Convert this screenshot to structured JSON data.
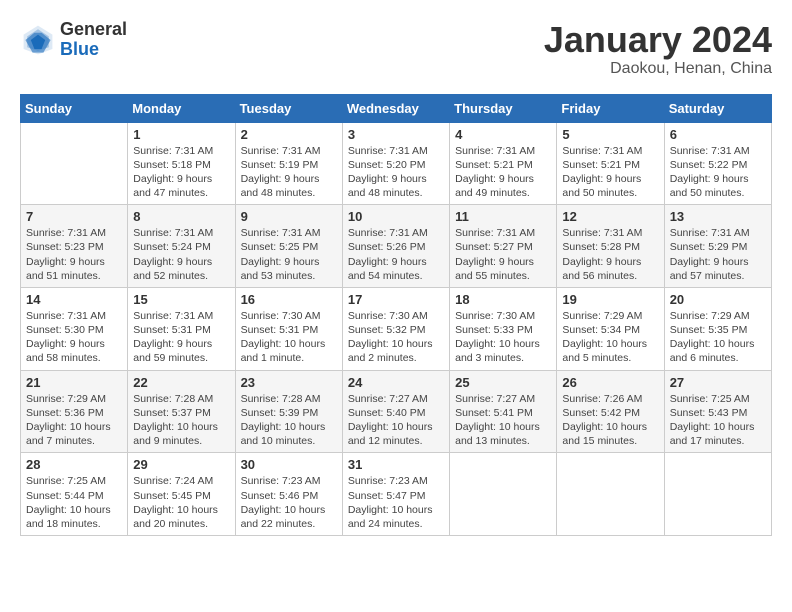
{
  "header": {
    "logo": {
      "general": "General",
      "blue": "Blue"
    },
    "title": "January 2024",
    "location": "Daokou, Henan, China"
  },
  "weekdays": [
    "Sunday",
    "Monday",
    "Tuesday",
    "Wednesday",
    "Thursday",
    "Friday",
    "Saturday"
  ],
  "weeks": [
    [
      {
        "day": "",
        "sunrise": "",
        "sunset": "",
        "daylight": ""
      },
      {
        "day": "1",
        "sunrise": "Sunrise: 7:31 AM",
        "sunset": "Sunset: 5:18 PM",
        "daylight": "Daylight: 9 hours and 47 minutes."
      },
      {
        "day": "2",
        "sunrise": "Sunrise: 7:31 AM",
        "sunset": "Sunset: 5:19 PM",
        "daylight": "Daylight: 9 hours and 48 minutes."
      },
      {
        "day": "3",
        "sunrise": "Sunrise: 7:31 AM",
        "sunset": "Sunset: 5:20 PM",
        "daylight": "Daylight: 9 hours and 48 minutes."
      },
      {
        "day": "4",
        "sunrise": "Sunrise: 7:31 AM",
        "sunset": "Sunset: 5:21 PM",
        "daylight": "Daylight: 9 hours and 49 minutes."
      },
      {
        "day": "5",
        "sunrise": "Sunrise: 7:31 AM",
        "sunset": "Sunset: 5:21 PM",
        "daylight": "Daylight: 9 hours and 50 minutes."
      },
      {
        "day": "6",
        "sunrise": "Sunrise: 7:31 AM",
        "sunset": "Sunset: 5:22 PM",
        "daylight": "Daylight: 9 hours and 50 minutes."
      }
    ],
    [
      {
        "day": "7",
        "sunrise": "Sunrise: 7:31 AM",
        "sunset": "Sunset: 5:23 PM",
        "daylight": "Daylight: 9 hours and 51 minutes."
      },
      {
        "day": "8",
        "sunrise": "Sunrise: 7:31 AM",
        "sunset": "Sunset: 5:24 PM",
        "daylight": "Daylight: 9 hours and 52 minutes."
      },
      {
        "day": "9",
        "sunrise": "Sunrise: 7:31 AM",
        "sunset": "Sunset: 5:25 PM",
        "daylight": "Daylight: 9 hours and 53 minutes."
      },
      {
        "day": "10",
        "sunrise": "Sunrise: 7:31 AM",
        "sunset": "Sunset: 5:26 PM",
        "daylight": "Daylight: 9 hours and 54 minutes."
      },
      {
        "day": "11",
        "sunrise": "Sunrise: 7:31 AM",
        "sunset": "Sunset: 5:27 PM",
        "daylight": "Daylight: 9 hours and 55 minutes."
      },
      {
        "day": "12",
        "sunrise": "Sunrise: 7:31 AM",
        "sunset": "Sunset: 5:28 PM",
        "daylight": "Daylight: 9 hours and 56 minutes."
      },
      {
        "day": "13",
        "sunrise": "Sunrise: 7:31 AM",
        "sunset": "Sunset: 5:29 PM",
        "daylight": "Daylight: 9 hours and 57 minutes."
      }
    ],
    [
      {
        "day": "14",
        "sunrise": "Sunrise: 7:31 AM",
        "sunset": "Sunset: 5:30 PM",
        "daylight": "Daylight: 9 hours and 58 minutes."
      },
      {
        "day": "15",
        "sunrise": "Sunrise: 7:31 AM",
        "sunset": "Sunset: 5:31 PM",
        "daylight": "Daylight: 9 hours and 59 minutes."
      },
      {
        "day": "16",
        "sunrise": "Sunrise: 7:30 AM",
        "sunset": "Sunset: 5:31 PM",
        "daylight": "Daylight: 10 hours and 1 minute."
      },
      {
        "day": "17",
        "sunrise": "Sunrise: 7:30 AM",
        "sunset": "Sunset: 5:32 PM",
        "daylight": "Daylight: 10 hours and 2 minutes."
      },
      {
        "day": "18",
        "sunrise": "Sunrise: 7:30 AM",
        "sunset": "Sunset: 5:33 PM",
        "daylight": "Daylight: 10 hours and 3 minutes."
      },
      {
        "day": "19",
        "sunrise": "Sunrise: 7:29 AM",
        "sunset": "Sunset: 5:34 PM",
        "daylight": "Daylight: 10 hours and 5 minutes."
      },
      {
        "day": "20",
        "sunrise": "Sunrise: 7:29 AM",
        "sunset": "Sunset: 5:35 PM",
        "daylight": "Daylight: 10 hours and 6 minutes."
      }
    ],
    [
      {
        "day": "21",
        "sunrise": "Sunrise: 7:29 AM",
        "sunset": "Sunset: 5:36 PM",
        "daylight": "Daylight: 10 hours and 7 minutes."
      },
      {
        "day": "22",
        "sunrise": "Sunrise: 7:28 AM",
        "sunset": "Sunset: 5:37 PM",
        "daylight": "Daylight: 10 hours and 9 minutes."
      },
      {
        "day": "23",
        "sunrise": "Sunrise: 7:28 AM",
        "sunset": "Sunset: 5:39 PM",
        "daylight": "Daylight: 10 hours and 10 minutes."
      },
      {
        "day": "24",
        "sunrise": "Sunrise: 7:27 AM",
        "sunset": "Sunset: 5:40 PM",
        "daylight": "Daylight: 10 hours and 12 minutes."
      },
      {
        "day": "25",
        "sunrise": "Sunrise: 7:27 AM",
        "sunset": "Sunset: 5:41 PM",
        "daylight": "Daylight: 10 hours and 13 minutes."
      },
      {
        "day": "26",
        "sunrise": "Sunrise: 7:26 AM",
        "sunset": "Sunset: 5:42 PM",
        "daylight": "Daylight: 10 hours and 15 minutes."
      },
      {
        "day": "27",
        "sunrise": "Sunrise: 7:25 AM",
        "sunset": "Sunset: 5:43 PM",
        "daylight": "Daylight: 10 hours and 17 minutes."
      }
    ],
    [
      {
        "day": "28",
        "sunrise": "Sunrise: 7:25 AM",
        "sunset": "Sunset: 5:44 PM",
        "daylight": "Daylight: 10 hours and 18 minutes."
      },
      {
        "day": "29",
        "sunrise": "Sunrise: 7:24 AM",
        "sunset": "Sunset: 5:45 PM",
        "daylight": "Daylight: 10 hours and 20 minutes."
      },
      {
        "day": "30",
        "sunrise": "Sunrise: 7:23 AM",
        "sunset": "Sunset: 5:46 PM",
        "daylight": "Daylight: 10 hours and 22 minutes."
      },
      {
        "day": "31",
        "sunrise": "Sunrise: 7:23 AM",
        "sunset": "Sunset: 5:47 PM",
        "daylight": "Daylight: 10 hours and 24 minutes."
      },
      {
        "day": "",
        "sunrise": "",
        "sunset": "",
        "daylight": ""
      },
      {
        "day": "",
        "sunrise": "",
        "sunset": "",
        "daylight": ""
      },
      {
        "day": "",
        "sunrise": "",
        "sunset": "",
        "daylight": ""
      }
    ]
  ]
}
